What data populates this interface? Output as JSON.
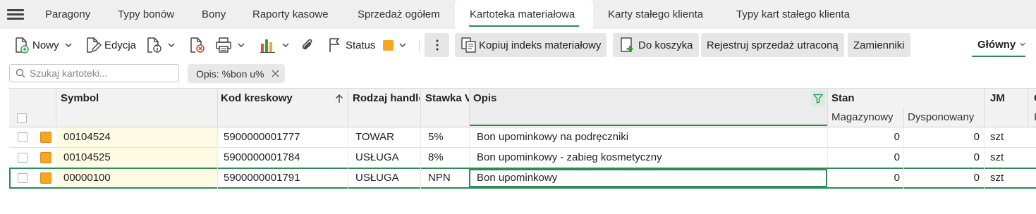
{
  "tabs": [
    {
      "label": "Paragony",
      "active": false
    },
    {
      "label": "Typy bonów",
      "active": false
    },
    {
      "label": "Bony",
      "active": false
    },
    {
      "label": "Raporty kasowe",
      "active": false
    },
    {
      "label": "Sprzedaż ogółem",
      "active": false
    },
    {
      "label": "Kartoteka materiałowa",
      "active": true
    },
    {
      "label": "Karty stałego klienta",
      "active": false
    },
    {
      "label": "Typy kart stałego klienta",
      "active": false
    }
  ],
  "toolbar": {
    "new_label": "Nowy",
    "edit_label": "Edycja",
    "status_label": "Status",
    "status_color": "#f5a623",
    "copy_index_label": "Kopiuj indeks materiałowy",
    "to_cart_label": "Do koszyka",
    "register_lost_sale_label": "Rejestruj sprzedaż utraconą",
    "substitutes_label": "Zamienniki",
    "view_label": "Główny"
  },
  "search": {
    "placeholder": "Szukaj kartoteki...",
    "value": ""
  },
  "filter_chip": {
    "label": "Opis: %bon u%"
  },
  "grid": {
    "headers": {
      "symbol": "Symbol",
      "barcode": "Kod kreskowy",
      "trade_type": "Rodzaj handlo",
      "vat": "Stawka V",
      "description": "Opis",
      "stock": "Stan",
      "stock_warehouse": "Magazynowy",
      "stock_available": "Dysponowany",
      "unit": "JM",
      "next_col": "C",
      "next_sub": "I"
    },
    "rows": [
      {
        "symbol": "00104524",
        "barcode": "5900000001777",
        "trade_type": "TOWAR",
        "vat": "5%",
        "description": "Bon upominkowy na podręczniki",
        "stock_warehouse": "0",
        "stock_available": "0",
        "unit": "szt",
        "selected": false
      },
      {
        "symbol": "00104525",
        "barcode": "5900000001784",
        "trade_type": "USŁUGA",
        "vat": "8%",
        "description": "Bon upominkowy - zabieg kosmetyczny",
        "stock_warehouse": "0",
        "stock_available": "0",
        "unit": "szt",
        "selected": false
      },
      {
        "symbol": "00000100",
        "barcode": "5900000001791",
        "trade_type": "USŁUGA",
        "vat": "NPN",
        "description": "Bon upominkowy",
        "stock_warehouse": "0",
        "stock_available": "0",
        "unit": "szt",
        "selected": true
      }
    ]
  },
  "colors": {
    "accent": "#2e8b57",
    "status_square": "#f5a623",
    "symbol_highlight": "#fdfbe3"
  }
}
